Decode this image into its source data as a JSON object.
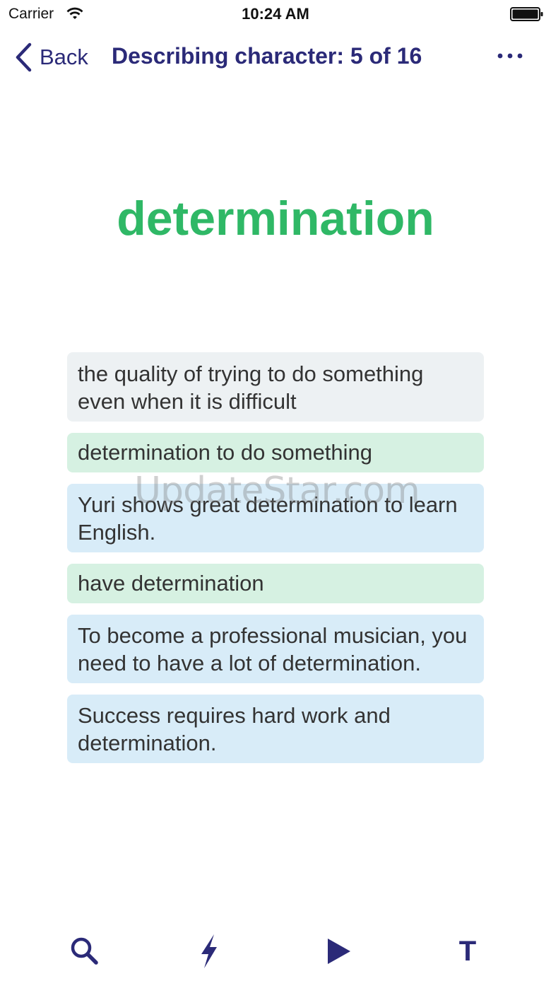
{
  "status_bar": {
    "carrier": "Carrier",
    "time": "10:24 AM"
  },
  "nav": {
    "back_label": "Back",
    "title": "Describing character: 5 of 16"
  },
  "headword": "determination",
  "cards": [
    {
      "kind": "definition",
      "text": "the quality of trying to do something even when it is difficult"
    },
    {
      "kind": "collocation",
      "text": "determination to do something"
    },
    {
      "kind": "example",
      "text": "Yuri shows great determination to learn English."
    },
    {
      "kind": "collocation",
      "text": "have determination"
    },
    {
      "kind": "example",
      "text": "To become a professional musician, you need to have a lot of determination."
    },
    {
      "kind": "example",
      "text": "Success requires hard work and determination."
    }
  ],
  "watermark": "UpdateStar.com",
  "toolbar": {
    "search_icon": "search-icon",
    "flash_icon": "lightning-icon",
    "play_icon": "play-icon",
    "text_label": "T"
  },
  "colors": {
    "accent": "#2b2a78",
    "headword": "#2fb866",
    "definition_bg": "#edf1f3",
    "collocation_bg": "#d6f1e2",
    "example_bg": "#d8ecf8"
  }
}
